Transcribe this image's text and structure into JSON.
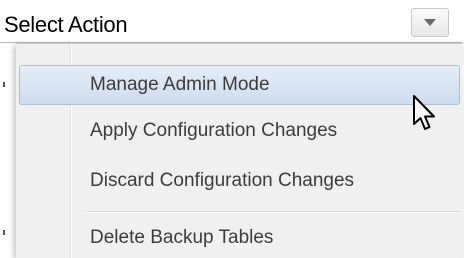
{
  "select": {
    "value": "Select Action",
    "dropdown_icon": "triangle-down-icon"
  },
  "menu": {
    "items": [
      {
        "label": "Manage Admin Mode",
        "highlighted": true
      },
      {
        "label": "Apply Configuration Changes",
        "highlighted": false
      },
      {
        "label": "Discard Configuration Changes",
        "highlighted": false
      },
      {
        "label": "Delete Backup Tables",
        "highlighted": false
      }
    ]
  },
  "cursor": {
    "icon": "mouse-pointer-icon"
  },
  "colors": {
    "highlight": "#cedcee",
    "highlight_border": "#a9bfdc",
    "menu_background": "#f0f0f0",
    "menu_text": "#3c3c3c"
  }
}
